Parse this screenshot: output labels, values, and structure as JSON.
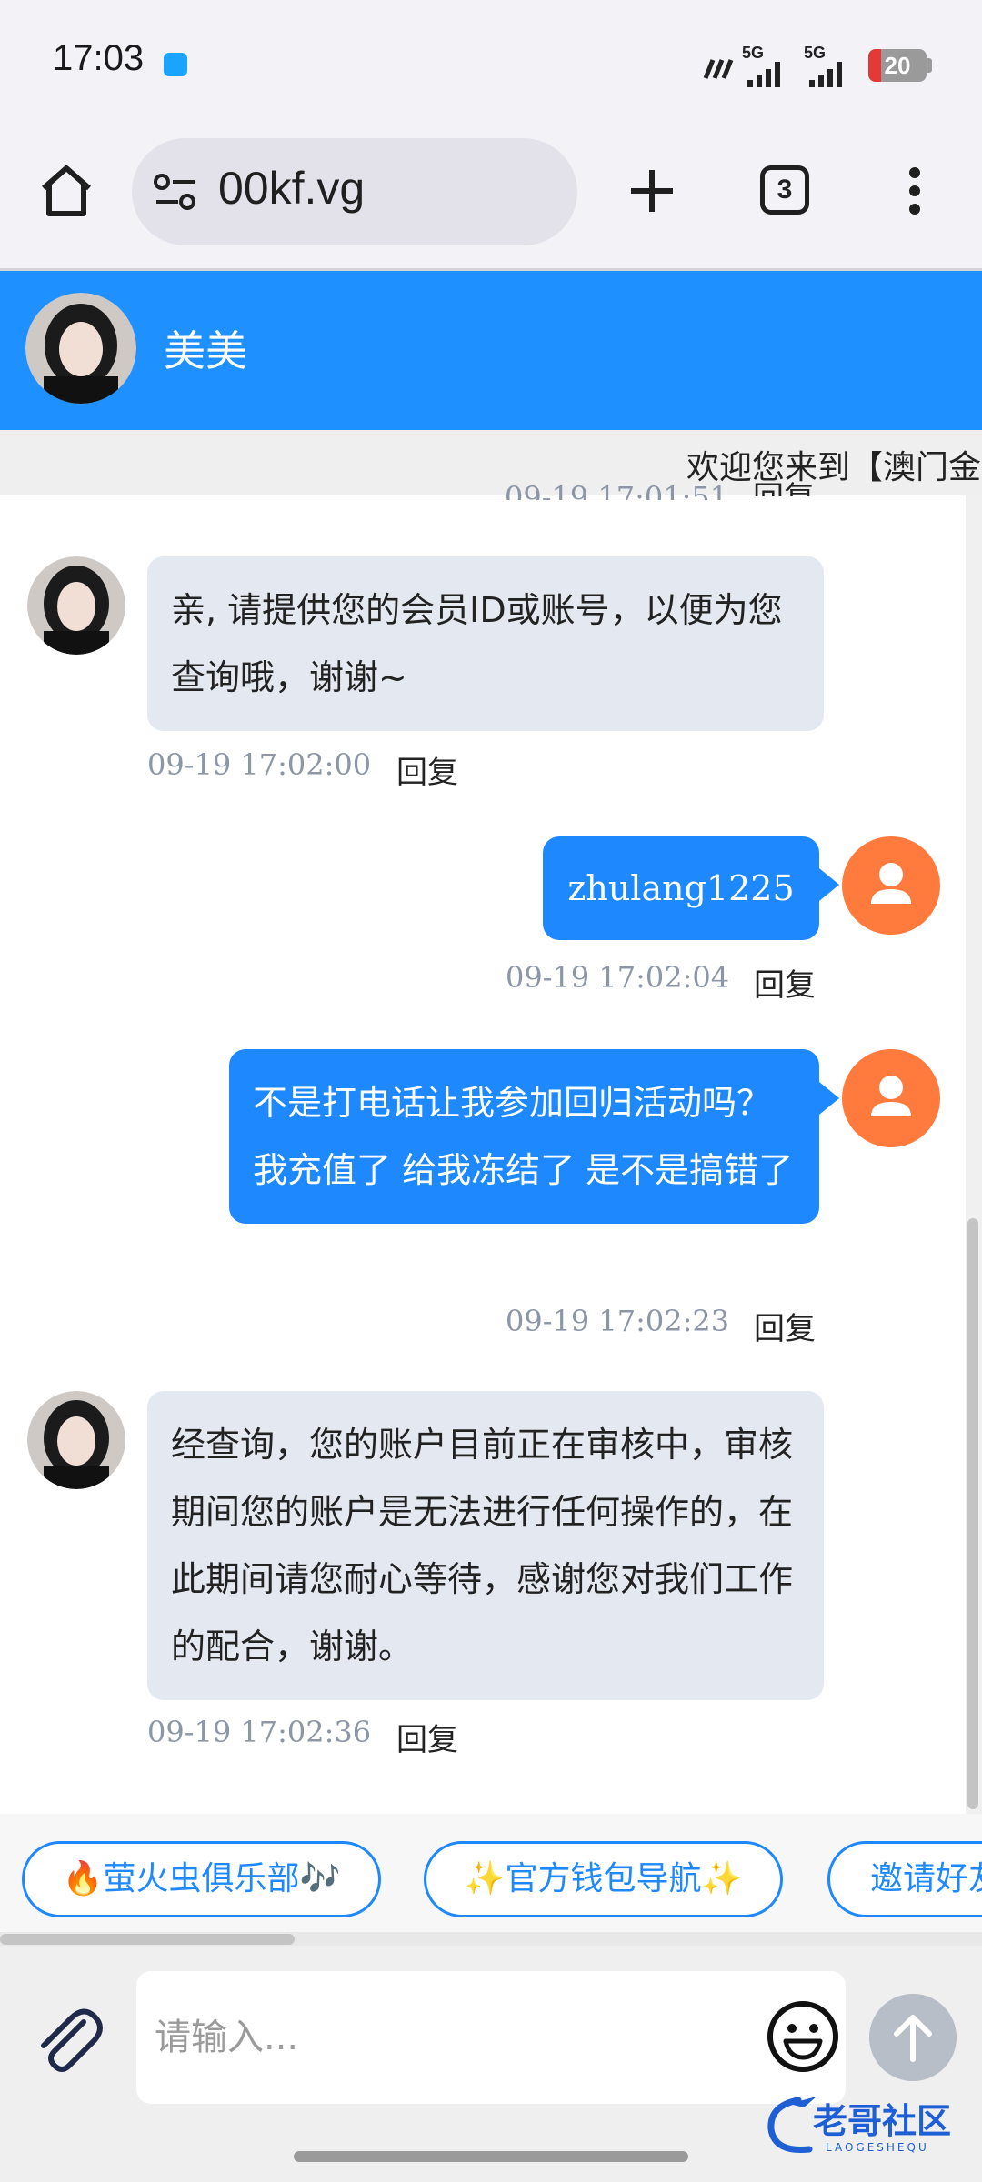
{
  "status_bar": {
    "time": "17:03",
    "network_1": "5G",
    "network_2": "5G",
    "battery": "20"
  },
  "browser": {
    "url": "00kf.vg",
    "tab_count": "3",
    "icons": [
      "home-icon",
      "site-settings-icon",
      "plus-icon",
      "tabs-icon",
      "more-vert-icon"
    ]
  },
  "chat_header": {
    "agent_name": "美美"
  },
  "marquee": {
    "text": "欢迎您来到【澳门金"
  },
  "messages": [
    {
      "side": "agent",
      "text": "亲, 请提供您的会员ID或账号，以便为您查询哦，谢谢~",
      "time": "09-19 17:02:00",
      "reply_label": "回复"
    },
    {
      "side": "user",
      "text": "zhulang1225",
      "time": "09-19 17:02:04",
      "reply_label": "回复"
    },
    {
      "side": "user",
      "text": "不是打电话让我参加回归活动吗？我充值了 给我冻结了 是不是搞错了",
      "time": "09-19 17:02:23",
      "reply_label": "回复"
    },
    {
      "side": "agent",
      "text": "经查询，您的账户目前正在审核中，审核期间您的账户是无法进行任何操作的，在此期间请您耐心等待，感谢您对我们工作的配合，谢谢。",
      "time": "09-19 17:02:36",
      "reply_label": "回复"
    }
  ],
  "cut_off_reply_label": "回复",
  "quick_links": [
    "🔥萤火虫俱乐部🎶",
    "✨官方钱包导航✨",
    "邀请好友"
  ],
  "input": {
    "placeholder": "请输入..."
  },
  "watermark": {
    "text": "老哥社区",
    "subtext": "LAOGESHEQU"
  },
  "colors": {
    "header_blue": "#1e90ff",
    "user_bubble": "#1e88ff",
    "agent_bubble": "#e4e8f0",
    "user_avatar": "#ff7a3d"
  }
}
